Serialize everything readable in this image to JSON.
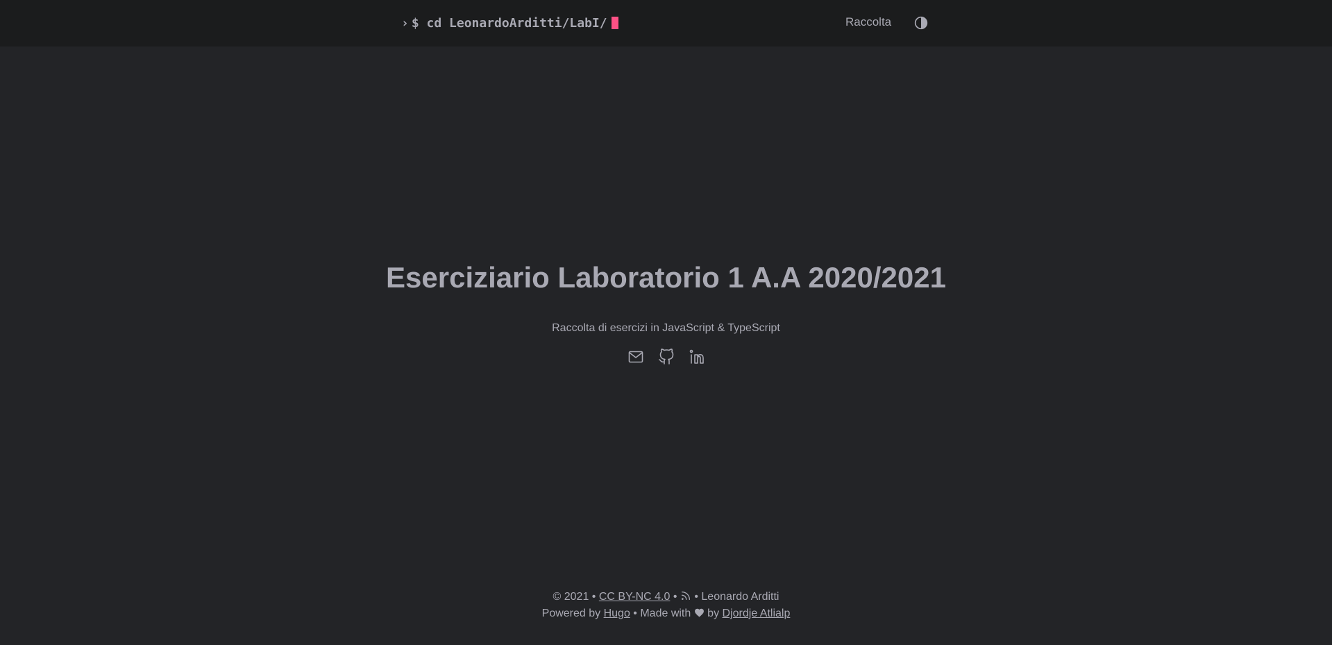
{
  "header": {
    "logo": {
      "chevron": "›",
      "command": "$ cd LeonardoArditti/LabI/"
    },
    "menu": [
      {
        "label": "Raccolta"
      }
    ],
    "theme_toggle_icon": "half-circle-contrast-icon"
  },
  "hero": {
    "title": "Eserciziario Laboratorio 1 A.A 2020/2021",
    "subtitle": "Raccolta di esercizi in JavaScript & TypeScript",
    "socials": [
      {
        "icon": "mail-icon"
      },
      {
        "icon": "github-icon"
      },
      {
        "icon": "linkedin-icon"
      }
    ]
  },
  "footer": {
    "copyright": "© 2021",
    "separator": " • ",
    "license": "CC BY-NC 4.0",
    "author": "Leonardo Arditti",
    "powered_by": "Powered by",
    "generator": "Hugo",
    "made_with": "Made with",
    "by": "by",
    "theme_author": "Djordje Atlialp"
  },
  "colors": {
    "background": "#232427",
    "navbar": "#1b1c1d",
    "text": "#a9a9b3",
    "cursor": "#fe5186"
  }
}
